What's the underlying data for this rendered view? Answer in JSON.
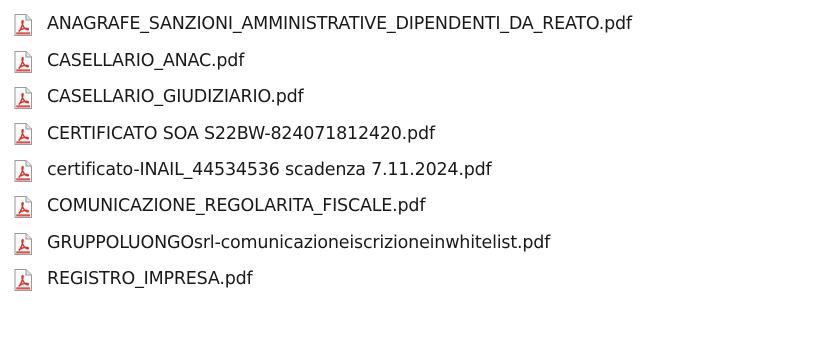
{
  "file_list": {
    "icon": "pdf-file-icon",
    "colors": {
      "icon_accent": "#d9342b",
      "text": "#1a1a1a",
      "background": "#ffffff"
    },
    "files": [
      {
        "name": "ANAGRAFE_SANZIONI_AMMINISTRATIVE_DIPENDENTI_DA_REATO.pdf"
      },
      {
        "name": "CASELLARIO_ANAC.pdf"
      },
      {
        "name": "CASELLARIO_GIUDIZIARIO.pdf"
      },
      {
        "name": "CERTIFICATO SOA S22BW-824071812420.pdf"
      },
      {
        "name": "certificato-INAIL_44534536 scadenza 7.11.2024.pdf"
      },
      {
        "name": "COMUNICAZIONE_REGOLARITA_FISCALE.pdf"
      },
      {
        "name": "GRUPPOLUONGOsrl-comunicazioneiscrizioneinwhitelist.pdf"
      },
      {
        "name": "REGISTRO_IMPRESA.pdf"
      }
    ]
  }
}
